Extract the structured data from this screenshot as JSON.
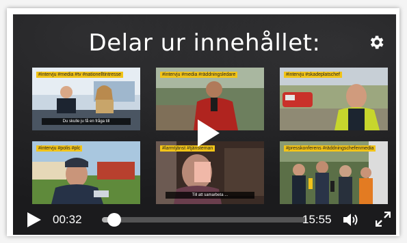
{
  "player": {
    "title": "Delar ur innehållet:",
    "progress_fraction": 0.06,
    "current_time": "00:32",
    "duration": "15:55"
  },
  "thumbnails": [
    {
      "tag": "#intervju #media #tv #nationelltintresse",
      "subtitle": "Du skulle ju få en fråga till"
    },
    {
      "tag": "#intervju #media #räddningsledare",
      "subtitle": ""
    },
    {
      "tag": "#intervju #skadeplatschef",
      "subtitle": ""
    },
    {
      "tag": "#intervju #polis #plc",
      "subtitle": ""
    },
    {
      "tag": "#larmtjänst #tjänsteman",
      "subtitle": "Till att samarbeta ..."
    },
    {
      "tag": "#presskonferens #räddningschefenmedia",
      "subtitle": ""
    }
  ],
  "icons": {
    "settings": "gear-icon",
    "big_play": "play-icon",
    "play": "play-icon",
    "volume": "volume-icon",
    "fullscreen": "fullscreen-icon"
  },
  "colors": {
    "tag_bg": "#f2c418",
    "player_bg": "#1b1b1d"
  }
}
